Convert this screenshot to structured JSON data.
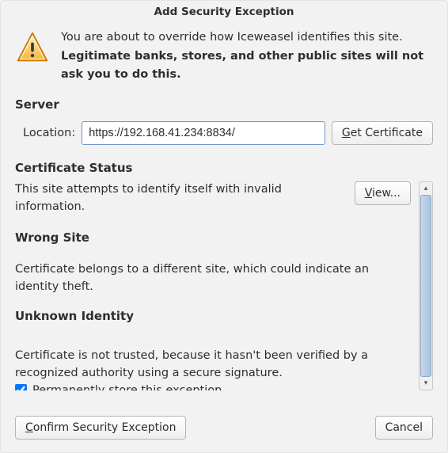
{
  "title": "Add Security Exception",
  "warning": {
    "line1": "You are about to override how Iceweasel identifies this site.",
    "line2": "Legitimate banks, stores, and other public sites will not ask you to do this."
  },
  "server": {
    "heading": "Server",
    "location_label": "Location:",
    "url_value": "https://192.168.41.234:8834/",
    "get_cert_prefix": "G",
    "get_cert_rest": "et Certificate"
  },
  "status": {
    "heading": "Certificate Status",
    "intro": "This site attempts to identify itself with invalid information.",
    "view_prefix": "V",
    "view_rest": "iew...",
    "wrong_site_heading": "Wrong Site",
    "wrong_site_text": "Certificate belongs to a different site, which could indicate an identity theft.",
    "unknown_identity_heading": "Unknown Identity",
    "unknown_identity_text": "Certificate is not trusted, because it hasn't been verified by a recognized authority using a secure signature."
  },
  "checkbox": {
    "prefix": "P",
    "rest": "ermanently store this exception",
    "checked": true
  },
  "buttons": {
    "confirm_prefix": "C",
    "confirm_rest": "onfirm Security Exception",
    "cancel": "Cancel"
  }
}
